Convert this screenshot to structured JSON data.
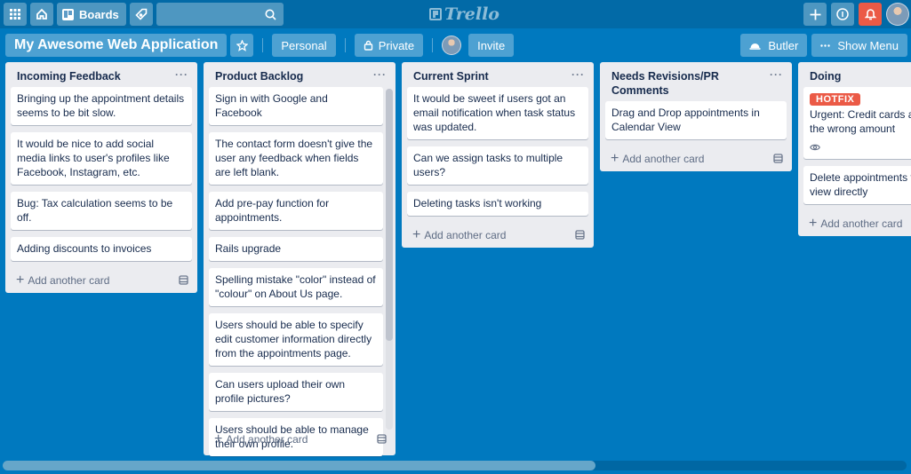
{
  "topbar": {
    "apps_icon": "grid-icon",
    "home_icon": "home-icon",
    "boards_label": "Boards",
    "tag_icon": "tag-icon",
    "search_placeholder": "",
    "logo_text": "Trello",
    "right_icons": [
      "plus-icon",
      "info-icon",
      "bell-icon",
      "avatar"
    ],
    "bell_color": "#eb5a46"
  },
  "board": {
    "title": "My Awesome Web Application",
    "visibility_team": "Personal",
    "visibility_privacy": "Private",
    "invite_label": "Invite",
    "butler_label": "Butler",
    "menu_label": "Show Menu",
    "background_color": "#0079bf"
  },
  "lists": [
    {
      "title": "Incoming Feedback",
      "cards": [
        {
          "text": "Bringing up the appointment details seems to be bit slow."
        },
        {
          "text": "It would be nice to add social media links to user's profiles like Facebook, Instagram, etc."
        },
        {
          "text": "Bug: Tax calculation seems to be off."
        },
        {
          "text": "Adding discounts to invoices"
        }
      ],
      "add_label": "Add another card"
    },
    {
      "title": "Product Backlog",
      "cards": [
        {
          "text": "Sign in with Google and Facebook"
        },
        {
          "text": "The contact form doesn't give the user any feedback when fields are left blank."
        },
        {
          "text": "Add pre-pay function for appointments."
        },
        {
          "text": "Rails upgrade"
        },
        {
          "text": "Spelling mistake \"color\" instead of \"colour\" on About Us page."
        },
        {
          "text": "Users should be able to specify edit customer information directly from the appointments page."
        },
        {
          "text": "Can users upload their own profile pictures?"
        },
        {
          "text": "Users should be able to manage their own profile."
        }
      ],
      "add_label": "Add another card"
    },
    {
      "title": "Current Sprint",
      "cards": [
        {
          "text": "It would be sweet if users got an email notification when task status was updated."
        },
        {
          "text": "Can we assign tasks to multiple users?"
        },
        {
          "text": "Deleting tasks isn't working"
        }
      ],
      "add_label": "Add another card"
    },
    {
      "title": "Needs Revisions/PR Comments",
      "cards": [
        {
          "text": "Drag and Drop appointments in Calendar View"
        }
      ],
      "add_label": "Add another card"
    },
    {
      "title": "Doing",
      "cards": [
        {
          "label": "HOTFIX",
          "label_color": "#eb5a46",
          "text": "Urgent: Credit cards are charged the wrong amount",
          "badge": "eye-icon"
        },
        {
          "text": "Delete appointments from Calendar view directly"
        }
      ],
      "add_label": "Add another card"
    }
  ]
}
